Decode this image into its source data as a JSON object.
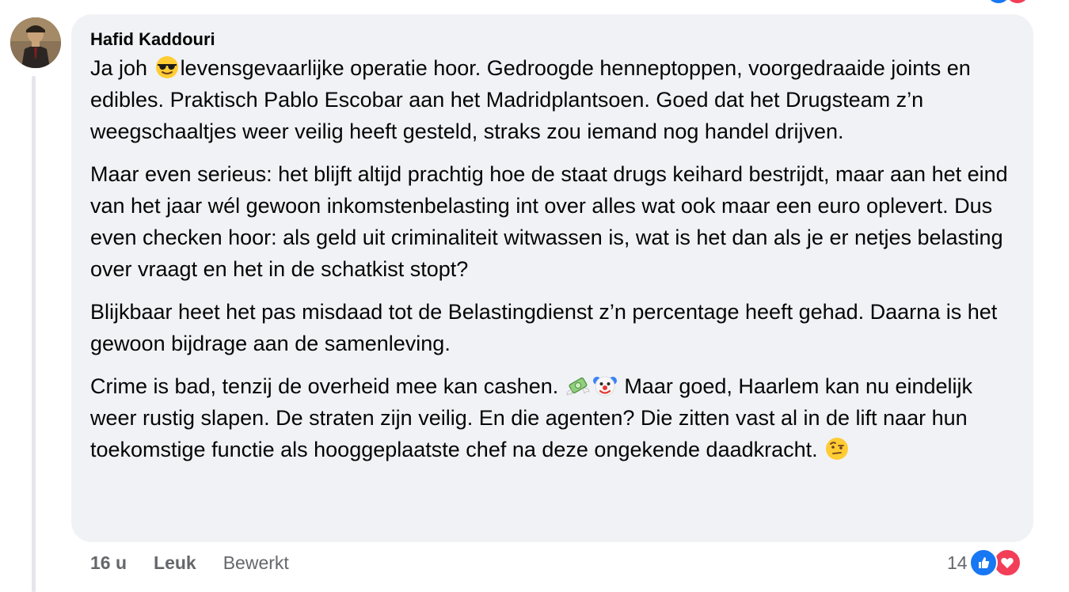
{
  "comment": {
    "author": "Hafid Kaddouri",
    "paragraphs": [
      {
        "segments": [
          {
            "type": "text",
            "value": "Ja joh "
          },
          {
            "type": "emoji",
            "name": "sunglasses-emoji"
          },
          {
            "type": "text",
            "value": "levensgevaarlijke operatie hoor. Gedroogde henneptoppen, voorgedraaide joints en edibles. Praktisch Pablo Escobar aan het Madridplantsoen. Goed dat het Drugsteam z’n weegschaaltjes weer veilig heeft gesteld, straks zou iemand nog handel drijven."
          }
        ]
      },
      {
        "segments": [
          {
            "type": "text",
            "value": "Maar even serieus: het blijft altijd prachtig hoe de staat drugs keihard bestrijdt, maar aan het eind van het jaar wél gewoon inkomstenbelasting int over alles wat ook maar een euro oplevert. Dus even checken hoor: als geld uit criminaliteit witwassen is, wat is het dan als je er netjes belasting over vraagt en het in de schatkist stopt?"
          }
        ]
      },
      {
        "segments": [
          {
            "type": "text",
            "value": "Blijkbaar heet het pas misdaad tot de Belastingdienst z’n percentage heeft gehad. Daarna is het gewoon bijdrage aan de samenleving."
          }
        ]
      },
      {
        "segments": [
          {
            "type": "text",
            "value": "Crime is bad, tenzij de overheid mee kan cashen. "
          },
          {
            "type": "emoji",
            "name": "money-with-wings-emoji"
          },
          {
            "type": "emoji",
            "name": "clown-emoji"
          },
          {
            "type": "text",
            "value": " Maar goed, Haarlem kan nu eindelijk weer rustig slapen. De straten zijn veilig. En die agenten? Die zitten vast al in de lift naar hun toekomstige functie als hooggeplaatste chef na deze ongekende daadkracht. "
          },
          {
            "type": "emoji",
            "name": "face-with-raised-eyebrow-emoji"
          }
        ]
      }
    ],
    "time": "16 u",
    "like_label": "Leuk",
    "edited_label": "Bewerkt",
    "reaction_count": "14",
    "reaction_icons": [
      "like-icon",
      "love-icon"
    ]
  },
  "colors": {
    "bubble": "#f0f2f5",
    "meta_text": "#65676b",
    "like": "#1877f2",
    "love": "#f33e58"
  }
}
